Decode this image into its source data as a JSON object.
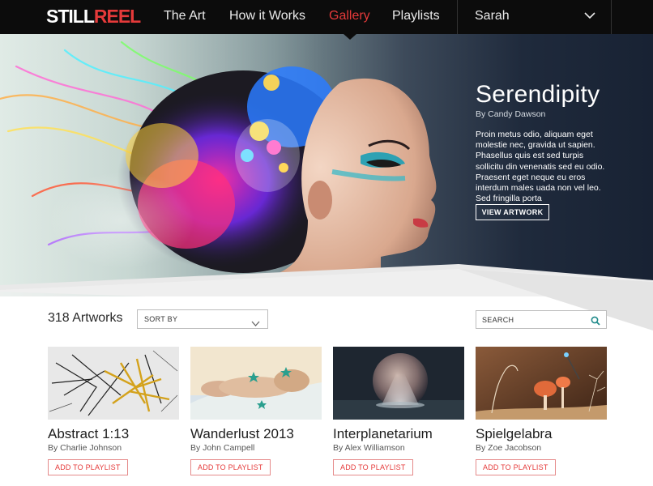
{
  "nav": {
    "logo_part1": "STILL",
    "logo_part2": "REEL",
    "items": [
      {
        "label": "The Art",
        "active": false
      },
      {
        "label": "How it Works",
        "active": false
      },
      {
        "label": "Gallery",
        "active": true
      },
      {
        "label": "Playlists",
        "active": false
      }
    ],
    "user_name": "Sarah",
    "user_menu_icon": "chevron-down-icon"
  },
  "hero": {
    "title": "Serendipity",
    "byline": "By Candy Dawson",
    "description": "Proin metus odio, aliquam eget molestie nec, gravida ut sapien. Phasellus quis est sed turpis sollicitu din venenatis sed eu odio. Praesent eget neque eu eros interdum males uada non vel leo. Sed fringilla porta",
    "button_label": "VIEW ARTWORK"
  },
  "toolbar": {
    "count_label": "318 Artworks",
    "sort_label": "SORT BY",
    "search_placeholder": "SEARCH",
    "search_icon": "search-icon"
  },
  "artworks": [
    {
      "title": "Abstract 1:13",
      "byline": "By Charlie Johnson",
      "button_label": "ADD TO PLAYLIST"
    },
    {
      "title": "Wanderlust 2013",
      "byline": "By John Campell",
      "button_label": "ADD TO PLAYLIST"
    },
    {
      "title": "Interplanetarium",
      "byline": "By Alex Williamson",
      "button_label": "ADD TO PLAYLIST"
    },
    {
      "title": "Spielgelabra",
      "byline": "By Zoe Jacobson",
      "button_label": "ADD TO PLAYLIST"
    }
  ],
  "colors": {
    "accent": "#e53a3a",
    "nav_bg": "#0c0c0c",
    "search_icon": "#1f8a8a"
  }
}
